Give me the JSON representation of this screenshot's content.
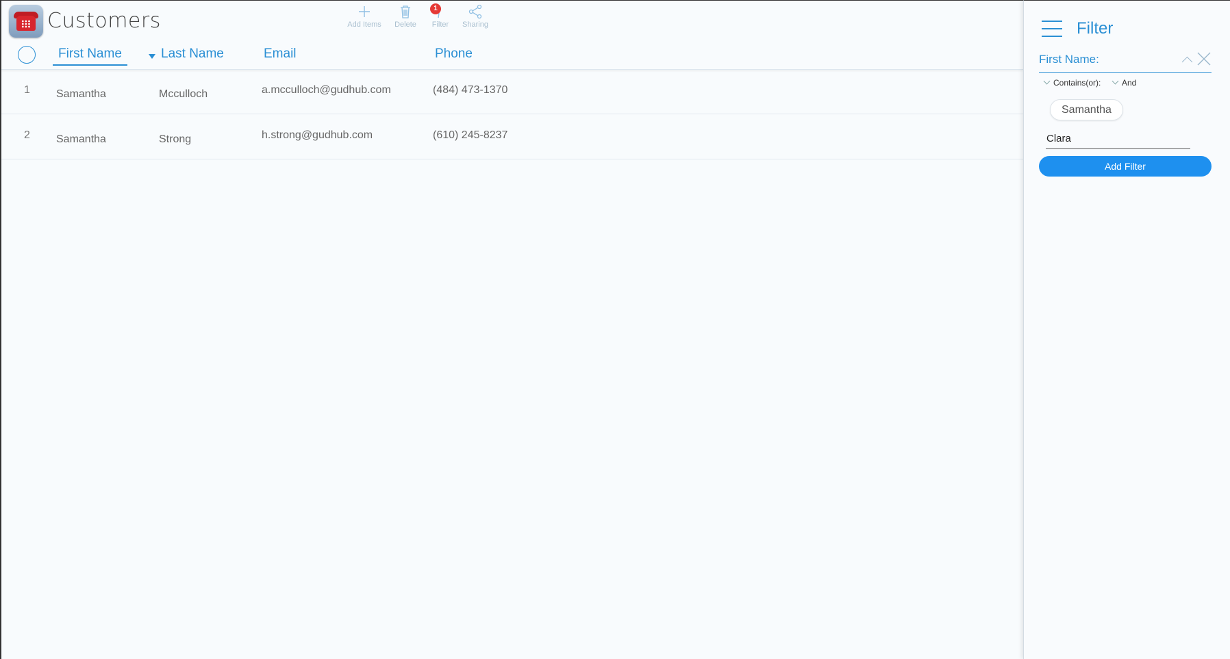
{
  "app": {
    "title": "Customers",
    "icon": "telephone-icon"
  },
  "toolbar": {
    "add_label": "Add Items",
    "delete_label": "Delete",
    "filter_label": "Filter",
    "filter_badge": "1",
    "sharing_label": "Sharing"
  },
  "table": {
    "columns": [
      "First Name",
      "Last Name",
      "Email",
      "Phone"
    ],
    "rows": [
      {
        "num": "1",
        "first": "Samantha",
        "last": "Mcculloch",
        "email": "a.mcculloch@gudhub.com",
        "phone": "(484) 473-1370"
      },
      {
        "num": "2",
        "first": "Samantha",
        "last": "Strong",
        "email": "h.strong@gudhub.com",
        "phone": "(610) 245-8237"
      }
    ]
  },
  "filter_panel": {
    "title": "Filter",
    "field_label": "First Name:",
    "condition": "Contains(or):",
    "logic": "And",
    "chip": "Samantha",
    "input_value": "Clara",
    "add_button": "Add Filter"
  },
  "colors": {
    "accent": "#2a8fd4",
    "button": "#1e90ef",
    "badge": "#e53935"
  }
}
